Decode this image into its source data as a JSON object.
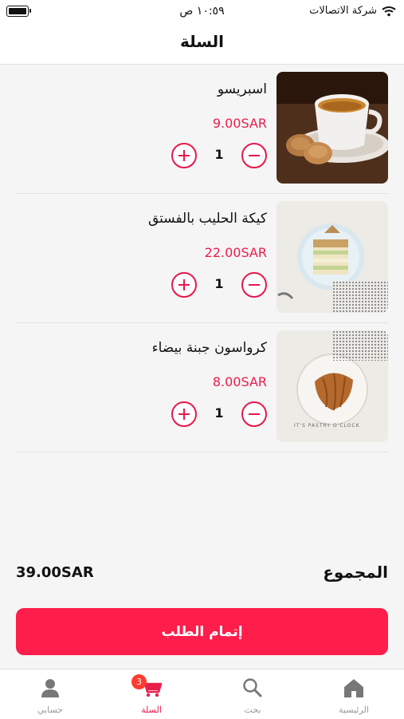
{
  "status_bar": {
    "carrier": "شركة الاتصالات",
    "time": "١٠:٥٩ ص"
  },
  "header": {
    "title": "السلة"
  },
  "cart": {
    "items": [
      {
        "name": "اسبريسو",
        "price": "9.00SAR",
        "quantity": "1"
      },
      {
        "name": "كيكة الحليب بالفستق",
        "price": "22.00SAR",
        "quantity": "1"
      },
      {
        "name": "كرواسون جبنة بيضاء",
        "price": "8.00SAR",
        "quantity": "1"
      }
    ]
  },
  "images": {
    "pastry_brand_text": "IT'S PASTRY O'CLOCK"
  },
  "summary": {
    "total_label": "المجموع",
    "total_value": "39.00SAR"
  },
  "checkout": {
    "label": "إتمام الطلب"
  },
  "tabbar": {
    "tabs": [
      {
        "label": "الرئيسية",
        "icon": "home-icon"
      },
      {
        "label": "بحث",
        "icon": "search-icon"
      },
      {
        "label": "السلة",
        "icon": "cart-icon",
        "badge": "3"
      },
      {
        "label": "حسابي",
        "icon": "profile-icon"
      }
    ],
    "active_tab": "السلة"
  },
  "colors": {
    "accent": "#fe1d4b",
    "price": "#e91e4b",
    "badge": "#ff3b30"
  }
}
